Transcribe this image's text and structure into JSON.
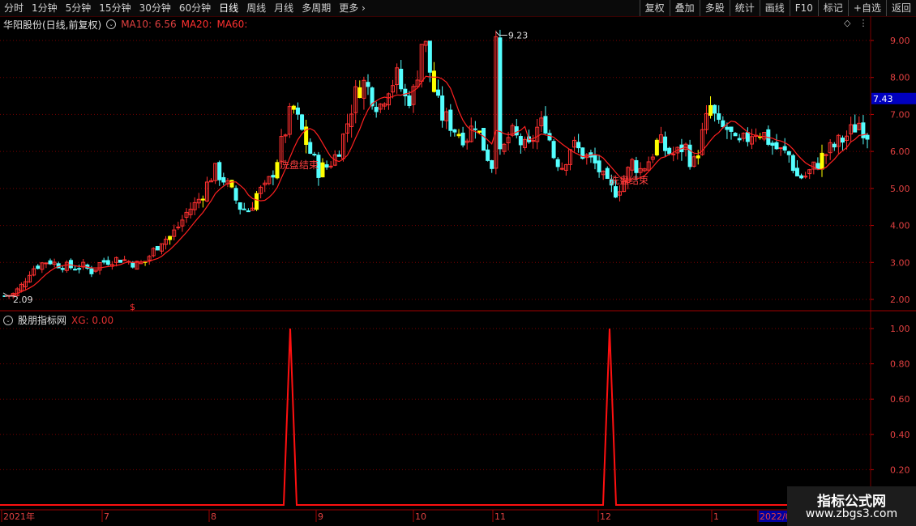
{
  "toolbar": {
    "periods": [
      "分时",
      "1分钟",
      "5分钟",
      "15分钟",
      "30分钟",
      "60分钟",
      "日线",
      "周线",
      "月线",
      "多周期",
      "更多"
    ],
    "more_icon": "chevron-right-icon",
    "buttons": [
      "复权",
      "叠加",
      "多股",
      "统计",
      "画线",
      "F10",
      "标记",
      "+自选",
      "返回"
    ]
  },
  "main_chart": {
    "stock_title": "华阳股份(日线,前复权)",
    "ma10_text": "MA10: 6.56",
    "ma20_text": "MA20:",
    "ma60_text": "MA60:",
    "price_axis": [
      "9.00",
      "8.00",
      "7.00",
      "6.00",
      "5.00",
      "4.00",
      "3.00",
      "2.00"
    ],
    "current_price": "7.43",
    "high_label": "9.23",
    "low_label": "2.09",
    "annotation_1": "洗盘结束",
    "annotation_2": "洗盘结束",
    "signal_mark": "$",
    "colors": {
      "up": "#ff3030",
      "down": "#54ffff",
      "signal_bar": "#ffff00",
      "ma": "#ff2020",
      "grid": "#7a0000"
    }
  },
  "indicator": {
    "name": "股朋指标网",
    "xg_text": "XG: 0.00",
    "axis": [
      "1.00",
      "0.80",
      "0.60",
      "0.40",
      "0.20"
    ]
  },
  "date_axis": [
    "2021年",
    "7",
    "8",
    "9",
    "10",
    "11",
    "12",
    "1",
    "2022/0"
  ],
  "watermark": {
    "line1": "指标公式网",
    "line2": "www.zbgs3.com"
  },
  "chart_data": [
    {
      "type": "candlestick",
      "title": "华阳股份(日线,前复权)",
      "y_ticks": [
        2,
        3,
        4,
        5,
        6,
        7,
        8,
        9
      ],
      "ylim": [
        1.7,
        9.5
      ],
      "marked_high": 9.23,
      "marked_low": 2.09,
      "last_price": 7.43,
      "x_ticks": [
        "2021年",
        "7",
        "8",
        "9",
        "10",
        "11",
        "12",
        "1",
        "2022/0"
      ],
      "close_path": [
        2.09,
        2.15,
        2.4,
        2.8,
        2.95,
        3.05,
        2.95,
        2.9,
        2.85,
        2.9,
        2.75,
        3.0,
        3.05,
        3.1,
        3.05,
        2.95,
        3.0,
        3.3,
        3.6,
        3.7,
        4.0,
        4.4,
        4.6,
        5.0,
        5.5,
        5.3,
        4.9,
        4.5,
        4.4,
        4.9,
        5.0,
        5.6,
        6.4,
        7.2,
        6.6,
        6.0,
        5.5,
        5.6,
        5.9,
        6.5,
        7.4,
        7.9,
        7.6,
        7.2,
        7.8,
        8.0,
        7.4,
        7.6,
        9.23,
        7.9,
        7.0,
        6.8,
        6.5,
        6.4,
        6.8,
        6.1,
        5.6,
        5.9,
        6.5,
        6.3,
        6.0,
        6.6,
        6.8,
        5.9,
        5.6,
        6.2,
        6.0,
        5.8,
        5.6,
        5.1,
        4.9,
        5.2,
        5.7,
        5.5,
        5.8,
        6.3,
        6.0,
        5.9,
        6.2,
        5.6,
        6.4,
        7.2,
        6.6,
        6.6,
        6.1,
        6.3,
        6.6,
        6.5,
        6.2,
        6.0,
        5.9,
        5.3,
        5.35,
        5.6,
        5.9,
        6.1,
        6.3,
        6.5,
        6.8,
        6.5
      ]
    },
    {
      "type": "line",
      "name": "XG",
      "ylim": [
        0,
        1.05
      ],
      "baseline": 0,
      "spikes": [
        {
          "x": "8",
          "value": 1.0
        },
        {
          "x": "12",
          "value": 1.0
        }
      ]
    }
  ]
}
